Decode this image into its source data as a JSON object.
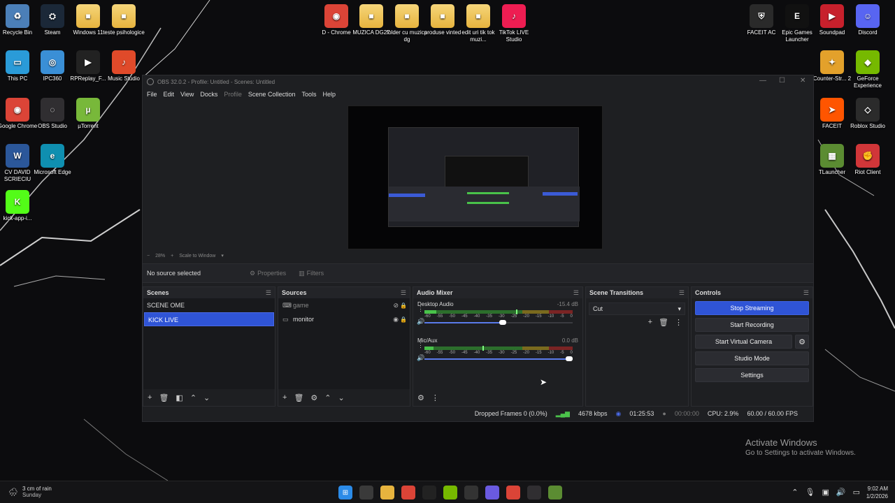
{
  "desktop": {
    "icons_left": [
      {
        "label": "Recycle Bin",
        "icon": "recycle-bin-icon",
        "color": "#4b7fb8"
      },
      {
        "label": "Steam",
        "icon": "steam-icon",
        "color": "#1b2838"
      },
      {
        "label": "Windows 11",
        "icon": "folder-icon",
        "color": "#e7b43e"
      },
      {
        "label": "teste psihologice",
        "icon": "folder-icon",
        "color": "#e7b43e"
      },
      {
        "label": "This PC",
        "icon": "monitor-icon",
        "color": "#2a9bd8"
      },
      {
        "label": "IPC360",
        "icon": "camera-app-icon",
        "color": "#3a8fd6"
      },
      {
        "label": "RPReplay_F...",
        "icon": "video-file-icon",
        "color": "#222"
      },
      {
        "label": "Music Studio",
        "icon": "music-studio-icon",
        "color": "#e04a2a"
      },
      {
        "label": "Google Chrome",
        "icon": "chrome-icon",
        "color": "#db4437"
      },
      {
        "label": "OBS Studio",
        "icon": "obs-icon",
        "color": "#302e31"
      },
      {
        "label": "µTorrent",
        "icon": "utorrent-icon",
        "color": "#78b83a"
      },
      {
        "label": "CV DAVID SCRIECIU",
        "icon": "word-doc-icon",
        "color": "#2b579a"
      },
      {
        "label": "Microsoft Edge",
        "icon": "edge-icon",
        "color": "#0f8fb0"
      },
      {
        "label": "kick-app-i...",
        "icon": "kick-icon",
        "color": "#53fc18"
      }
    ],
    "icons_top": [
      {
        "label": "D - Chrome",
        "icon": "chrome-icon",
        "color": "#db4437"
      },
      {
        "label": "MUZICA DG27",
        "icon": "folder-icon",
        "color": "#e7b43e"
      },
      {
        "label": "folder cu muzica dg",
        "icon": "folder-icon",
        "color": "#e7b43e"
      },
      {
        "label": "produse vinted",
        "icon": "folder-icon",
        "color": "#6aa84f"
      },
      {
        "label": "edit uri tik tok muzi...",
        "icon": "folder-icon",
        "color": "#e7b43e"
      },
      {
        "label": "TikTok LIVE Studio",
        "icon": "tiktok-icon",
        "color": "#ee1d52"
      }
    ],
    "icons_right": [
      {
        "label": "FACEIT AC",
        "icon": "faceit-ac-icon",
        "color": "#2a2a2a"
      },
      {
        "label": "Epic Games Launcher",
        "icon": "epic-games-icon",
        "color": "#111"
      },
      {
        "label": "Soundpad",
        "icon": "soundpad-icon",
        "color": "#c7202c"
      },
      {
        "label": "Discord",
        "icon": "discord-icon",
        "color": "#5865f2"
      },
      {
        "label": "Counter-Str... 2",
        "icon": "cs2-icon",
        "color": "#e3a12b"
      },
      {
        "label": "GeForce Experience",
        "icon": "geforce-icon",
        "color": "#76b900"
      },
      {
        "label": "FACEIT",
        "icon": "faceit-icon",
        "color": "#ff5500"
      },
      {
        "label": "Roblox Studio",
        "icon": "roblox-studio-icon",
        "color": "#2b2b2b"
      },
      {
        "label": "TLauncher",
        "icon": "tlauncher-icon",
        "color": "#5b8c32"
      },
      {
        "label": "Riot Client",
        "icon": "riot-client-icon",
        "color": "#d13639"
      }
    ],
    "activate_title": "Activate Windows",
    "activate_sub": "Go to Settings to activate Windows."
  },
  "obs": {
    "title": "OBS 32.0.2 - Profile: Untitled - Scenes: Untitled",
    "menu": [
      "File",
      "Edit",
      "View",
      "Docks",
      "Profile",
      "Scene Collection",
      "Tools",
      "Help"
    ],
    "zoom": {
      "minus": "−",
      "value": "28%",
      "plus": "+",
      "mode": "Scale to Window"
    },
    "no_source": "No source selected",
    "properties": "Properties",
    "filters": "Filters",
    "scenes": {
      "title": "Scenes",
      "items": [
        "SCENE OME",
        "KICK LIVE"
      ],
      "selected": "KICK LIVE"
    },
    "sources": {
      "title": "Sources",
      "items": [
        {
          "name": "game",
          "icon": "gamepad-icon",
          "visible": false
        },
        {
          "name": "monitor",
          "icon": "monitor-icon",
          "visible": true
        }
      ]
    },
    "mixer": {
      "title": "Audio Mixer",
      "channels": [
        {
          "name": "Desktop Audio",
          "db": "-15.4 dB",
          "level": 0.08,
          "peak": 0.62,
          "volume": 0.55
        },
        {
          "name": "Mic/Aux",
          "db": "0.0 dB",
          "level": 0.06,
          "peak": 0.39,
          "volume": 1.0
        }
      ],
      "ticks": [
        "-60",
        "-55",
        "-50",
        "-45",
        "-40",
        "-35",
        "-30",
        "-25",
        "-20",
        "-15",
        "-10",
        "-5",
        "0"
      ]
    },
    "transitions": {
      "title": "Scene Transitions",
      "selected": "Cut"
    },
    "controls": {
      "title": "Controls",
      "stop_streaming": "Stop Streaming",
      "start_recording": "Start Recording",
      "start_virtual_camera": "Start Virtual Camera",
      "studio_mode": "Studio Mode",
      "settings": "Settings"
    },
    "status": {
      "dropped": "Dropped Frames 0 (0.0%)",
      "kbps": "4678 kbps",
      "stream_time": "01:25:53",
      "rec_time": "00:00:00",
      "cpu": "CPU: 2.9%",
      "fps": "60.00 / 60.00 FPS"
    },
    "accent": "#2f54d6"
  },
  "taskbar": {
    "weather_line1": "3 cm of rain",
    "weather_line2": "Sunday",
    "apps": [
      {
        "icon": "windows-start-icon",
        "color": "#2b8be8"
      },
      {
        "icon": "calculator-icon",
        "color": "#3a3a3a"
      },
      {
        "icon": "file-explorer-icon",
        "color": "#e7b43e"
      },
      {
        "icon": "chrome-icon",
        "color": "#db4437"
      },
      {
        "icon": "capcut-icon",
        "color": "#222"
      },
      {
        "icon": "geforce-icon",
        "color": "#76b900"
      },
      {
        "icon": "chatgpt-icon",
        "color": "#333"
      },
      {
        "icon": "messenger-icon",
        "color": "#6a5ae0"
      },
      {
        "icon": "chrome-icon",
        "color": "#db4437"
      },
      {
        "icon": "obs-icon",
        "color": "#302e31"
      },
      {
        "icon": "minecraft-icon",
        "color": "#5b8c32"
      }
    ],
    "time": "9:02 AM",
    "date": "1/2/2026"
  }
}
